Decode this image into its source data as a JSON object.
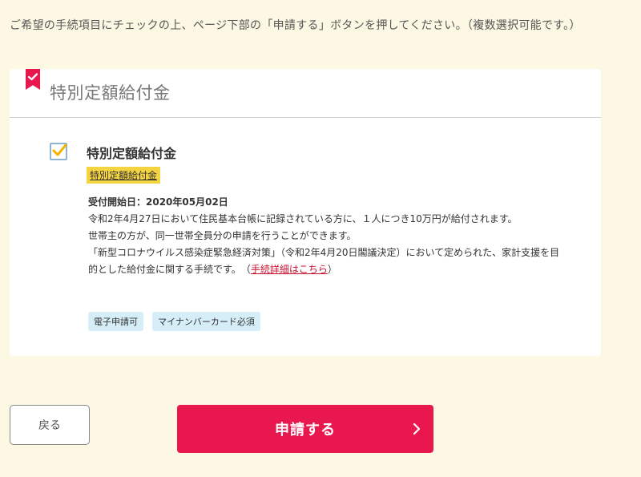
{
  "instruction": "ご希望の手続項目にチェックの上、ページ下部の「申請する」ボタンを押してください。（複数選択可能です。）",
  "card": {
    "header_title": "特別定額給付金",
    "item": {
      "checked": true,
      "title": "特別定額給付金",
      "tag_link": "特別定額給付金",
      "date_label": "受付開始日：2020年05月02日",
      "line1": "令和2年4月27日において住民基本台帳に記録されている方に、１人につき10万円が給付されます。",
      "line2": "世帯主の方が、同一世帯全員分の申請を行うことができます。",
      "line3_prefix": "「新型コロナウイルス感染症緊急経済対策」（令和2年4月20日閣議決定）において定められた、家計支援を目的とした給付金に関する手続です。　（",
      "detail_link": "手続詳細はこちら",
      "line3_suffix": "）",
      "badges": [
        "電子申請可",
        "マイナンバーカード必須"
      ]
    }
  },
  "buttons": {
    "back_label": "戻る",
    "submit_label": "申請する"
  },
  "colors": {
    "background": "#fdf8e4",
    "accent": "#e8184f",
    "tag_yellow": "#f5d442",
    "badge_blue": "#d6eef8",
    "link_red": "#c8102e"
  },
  "icons": {
    "ribbon": "bookmark-check-icon",
    "checkbox": "checkmark-icon",
    "submit_chevron": "chevron-right-icon"
  }
}
